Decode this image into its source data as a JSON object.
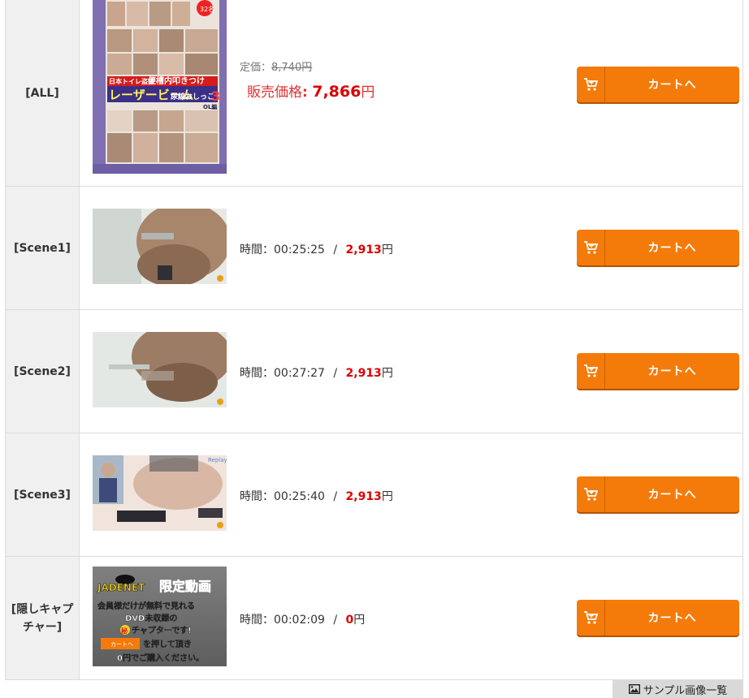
{
  "rows": [
    {
      "label": "[ALL]",
      "list_price_label": "定価：",
      "list_price": "8,740",
      "sale_label": "販売価格",
      "sale_colon": ":",
      "sale_price": "7,866",
      "yen": "円",
      "cart_label": "カートへ",
      "thumb": {
        "top_tag": "日本トイレ盗撮",
        "title1": "便槽内叩きつけ",
        "title2": "レーザービーム",
        "title3": "尿線おしっこ",
        "number": "3",
        "sub": "OL編",
        "badge": "32名"
      }
    },
    {
      "label": "[Scene1]",
      "time_label": "時間：",
      "time": "00:25:25",
      "sep": "/",
      "price": "2,913",
      "yen": "円",
      "cart_label": "カートへ"
    },
    {
      "label": "[Scene2]",
      "time_label": "時間：",
      "time": "00:27:27",
      "sep": "/",
      "price": "2,913",
      "yen": "円",
      "cart_label": "カートへ"
    },
    {
      "label": "[Scene3]",
      "time_label": "時間：",
      "time": "00:25:40",
      "sep": "/",
      "price": "2,913",
      "yen": "円",
      "cart_label": "カートへ",
      "thumb_text": "Replay"
    },
    {
      "label": "[隠しキャプチャー]",
      "time_label": "時間：",
      "time": "00:02:09",
      "sep": "/",
      "price": "0",
      "yen": "円",
      "cart_label": "カートへ",
      "banner": {
        "brand": "JADENET",
        "headline": "限定動画",
        "line1": "会員様だけが無料で見れる",
        "line2": "DVD未収録の",
        "line3_mark": "秘",
        "line3": "チャプターです!",
        "mini_btn": "カートへ",
        "line4": "を押して頂き",
        "line5": "0円でご購入ください。"
      }
    }
  ],
  "sample_tab": {
    "label": "サンプル画像一覧",
    "icon": "image-icon"
  },
  "colors": {
    "accent_orange": "#f47b0a",
    "price_red": "#dd0000",
    "label_bg": "#f0f0f0"
  }
}
